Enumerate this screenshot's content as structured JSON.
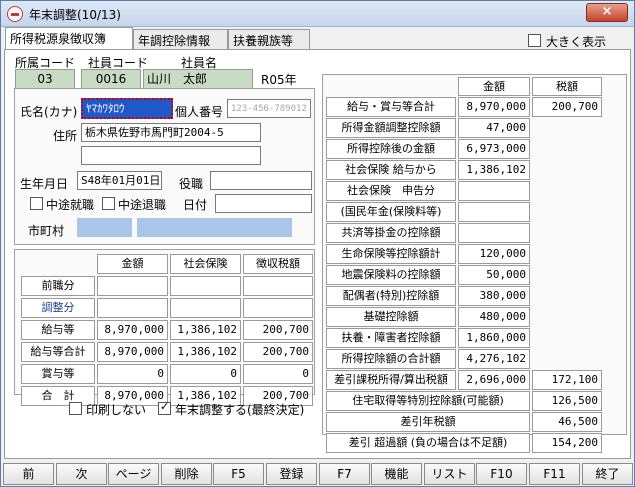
{
  "window": {
    "title": "年末調整(10/13)",
    "close": "×"
  },
  "tabs": [
    "所得税源泉徴収簿",
    "年調控除情報",
    "扶養親族等"
  ],
  "large_display": "大きく表示",
  "header": {
    "dept_code_label": "所属コード",
    "dept_code": "03",
    "emp_code_label": "社員コード",
    "emp_code": "0016",
    "emp_name_label": "社員名",
    "emp_name": "山川　太郎",
    "year": "R05年"
  },
  "person": {
    "kana_label": "氏名(カナ)",
    "kana": "ﾔﾏｶﾜﾀﾛｳ",
    "mynum_label": "個人番号",
    "mynum": "123-456-789012",
    "addr_label": "住所",
    "addr1": "栃木県佐野市馬門町2004-5",
    "addr2": "",
    "birth_label": "生年月日",
    "birth": "S48年01月01日",
    "role_label": "役職",
    "role": "",
    "join_label": "中途就職",
    "leave_label": "中途退職",
    "date_label": "日付",
    "date": "",
    "city_label": "市町村",
    "city_code": "",
    "city_name": ""
  },
  "left_table": {
    "headers": [
      "金額",
      "社会保険",
      "徴収税額"
    ],
    "rows": [
      {
        "label": "前職分",
        "link": false,
        "vals": [
          "",
          "",
          ""
        ],
        "style": ""
      },
      {
        "label": "調整分",
        "link": true,
        "vals": [
          "",
          "",
          ""
        ],
        "style": ""
      },
      {
        "label": "給与等",
        "link": false,
        "vals": [
          "8,970,000",
          "1,386,102",
          "200,700"
        ],
        "style": "mix"
      },
      {
        "label": "給与等合計",
        "link": false,
        "vals": [
          "8,970,000",
          "1,386,102",
          "200,700"
        ],
        "style": "green"
      },
      {
        "label": "賞与等",
        "link": false,
        "vals": [
          "0",
          "0",
          "0"
        ],
        "style": "blue"
      },
      {
        "label": "合　計",
        "link": false,
        "vals": [
          "8,970,000",
          "1,386,102",
          "200,700"
        ],
        "style": "green"
      }
    ]
  },
  "no_print": "印刷しない",
  "year_end": "年末調整する(最終決定)",
  "right_table": {
    "headers": [
      "金額",
      "税額"
    ],
    "rows": [
      {
        "label": "給与・賞与等合計",
        "amount": "8,970,000",
        "tax": "200,700",
        "astyle": "green",
        "tstyle": "green"
      },
      {
        "label": "所得金額調整控除額",
        "amount": "47,000",
        "tax": null,
        "astyle": "blue",
        "tstyle": ""
      },
      {
        "label": "所得控除後の金額",
        "amount": "6,973,000",
        "tax": null,
        "astyle": "blue",
        "tstyle": ""
      },
      {
        "label": "社会保険 給与から",
        "amount": "1,386,102",
        "tax": null,
        "astyle": "green",
        "tstyle": ""
      },
      {
        "label": "社会保険　申告分",
        "amount": "",
        "tax": null,
        "astyle": "",
        "tstyle": ""
      },
      {
        "label": "(国民年金(保険料等)",
        "amount": "",
        "tax": null,
        "astyle": "",
        "tstyle": ""
      },
      {
        "label": "共済等掛金の控除額",
        "amount": "",
        "tax": null,
        "astyle": "",
        "tstyle": ""
      },
      {
        "label": "生命保険等控除額計",
        "amount": "120,000",
        "tax": null,
        "astyle": "blue",
        "tstyle": ""
      },
      {
        "label": "地震保険料の控除額",
        "amount": "50,000",
        "tax": null,
        "astyle": "blue",
        "tstyle": ""
      },
      {
        "label": "配偶者(特別)控除額",
        "amount": "380,000",
        "tax": null,
        "astyle": "blue",
        "tstyle": ""
      },
      {
        "label": "基礎控除額",
        "amount": "480,000",
        "tax": null,
        "astyle": "blue",
        "tstyle": ""
      },
      {
        "label": "扶養・障害者控除額",
        "amount": "1,860,000",
        "tax": null,
        "astyle": "blue",
        "tstyle": ""
      },
      {
        "label": "所得控除額の合計額",
        "amount": "4,276,102",
        "tax": null,
        "astyle": "green",
        "tstyle": ""
      },
      {
        "label": "差引課税所得/算出税額",
        "amount": "2,696,000",
        "tax": "172,100",
        "astyle": "green",
        "tstyle": "green"
      }
    ],
    "housing_label": "住宅取得等特別控除額(可能額)",
    "housing": "126,500",
    "annual_label": "差引年税額",
    "annual": "46,500",
    "excess_label": "差引 超過額 (負の場合は不足額)",
    "excess": "154,200"
  },
  "fbuttons": [
    "前",
    "次",
    "ページ",
    "削除",
    "F5",
    "登録",
    "F7",
    "機能",
    "リスト",
    "F10",
    "F11",
    "終了"
  ]
}
